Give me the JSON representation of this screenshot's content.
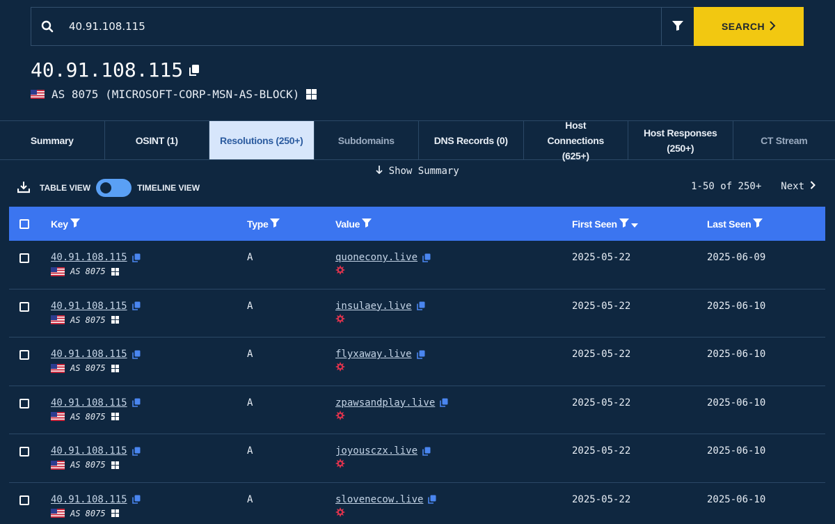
{
  "search": {
    "value": "40.91.108.115",
    "button_label": "SEARCH"
  },
  "header": {
    "ip": "40.91.108.115",
    "as_text": "AS 8075 (MICROSOFT-CORP-MSN-AS-BLOCK)"
  },
  "tabs": [
    {
      "label": "Summary",
      "state": "normal"
    },
    {
      "label": "OSINT (1)",
      "state": "normal"
    },
    {
      "label": "Resolutions (250+)",
      "state": "active"
    },
    {
      "label": "Subdomains",
      "state": "muted"
    },
    {
      "label": "DNS Records (0)",
      "state": "normal"
    },
    {
      "label": "Host Connections (625+)",
      "state": "normal"
    },
    {
      "label": "Host Responses (250+)",
      "state": "normal"
    },
    {
      "label": "CT Stream",
      "state": "muted"
    }
  ],
  "toolbar": {
    "show_summary": "Show Summary",
    "table_view": "TABLE VIEW",
    "timeline_view": "TIMELINE VIEW",
    "range": "1-50 of 250+",
    "next": "Next"
  },
  "table": {
    "headers": {
      "key": "Key",
      "type": "Type",
      "value": "Value",
      "first_seen": "First Seen",
      "last_seen": "Last Seen"
    },
    "rows": [
      {
        "key": "40.91.108.115",
        "asn": "AS 8075",
        "type": "A",
        "value": "quonecony.live",
        "first_seen": "2025-05-22",
        "last_seen": "2025-06-09"
      },
      {
        "key": "40.91.108.115",
        "asn": "AS 8075",
        "type": "A",
        "value": "insulaey.live",
        "first_seen": "2025-05-22",
        "last_seen": "2025-06-10"
      },
      {
        "key": "40.91.108.115",
        "asn": "AS 8075",
        "type": "A",
        "value": "flyxaway.live",
        "first_seen": "2025-05-22",
        "last_seen": "2025-06-10"
      },
      {
        "key": "40.91.108.115",
        "asn": "AS 8075",
        "type": "A",
        "value": "zpawsandplay.live",
        "first_seen": "2025-05-22",
        "last_seen": "2025-06-10"
      },
      {
        "key": "40.91.108.115",
        "asn": "AS 8075",
        "type": "A",
        "value": "joyousczx.live",
        "first_seen": "2025-05-22",
        "last_seen": "2025-06-10"
      },
      {
        "key": "40.91.108.115",
        "asn": "AS 8075",
        "type": "A",
        "value": "slovenecow.live",
        "first_seen": "2025-05-22",
        "last_seen": "2025-06-10"
      }
    ]
  },
  "colors": {
    "background": "#0f2740",
    "accent": "#f2c811",
    "table_header": "#3b75f0",
    "malicious": "#e0334d",
    "active_tab": "#d7e6fb"
  },
  "icons": [
    "search-icon",
    "filter-icon",
    "chevron-right-icon",
    "copy-icon",
    "flag-us-icon",
    "microsoft-logo-icon",
    "download-icon",
    "arrow-down-icon",
    "malicious-icon",
    "sort-desc-icon"
  ]
}
